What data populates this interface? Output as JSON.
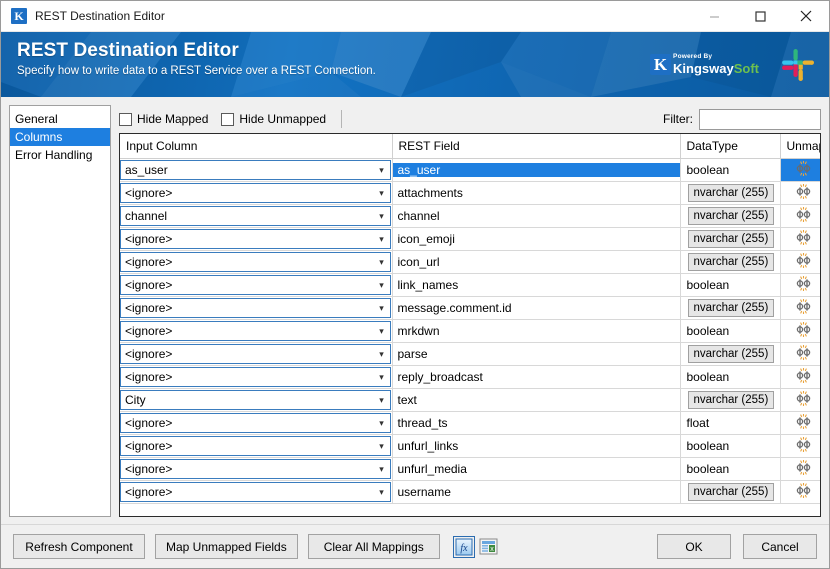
{
  "window": {
    "title": "REST Destination Editor",
    "app_icon": "kingswaysoft-k-icon",
    "minimize_label": "minimize-icon",
    "maximize_label": "maximize-icon",
    "close_label": "close-icon"
  },
  "banner": {
    "title": "REST Destination Editor",
    "subtitle": "Specify how to write data to a REST Service over a REST Connection.",
    "brand": {
      "k": "K",
      "powered_by": "Powered By",
      "name_part1": "Kingsway",
      "name_part2": "Soft"
    },
    "product_logo": "slack-logo"
  },
  "sidebar": {
    "items": [
      {
        "label": "General",
        "selected": false
      },
      {
        "label": "Columns",
        "selected": true
      },
      {
        "label": "Error Handling",
        "selected": false
      }
    ]
  },
  "toolbar": {
    "hide_mapped_label": "Hide Mapped",
    "hide_mapped_checked": false,
    "hide_unmapped_label": "Hide Unmapped",
    "hide_unmapped_checked": false,
    "filter_label": "Filter:",
    "filter_value": "",
    "filter_placeholder": ""
  },
  "grid": {
    "columns": [
      "Input Column",
      "REST Field",
      "DataType",
      "Unmap"
    ],
    "unmap_icon": "unmap-icon",
    "dropdown_icon": "chevron-down-icon",
    "rows": [
      {
        "input": "as_user",
        "rest": "as_user",
        "type": "boolean",
        "type_is_button": false,
        "selected": true
      },
      {
        "input": "<ignore>",
        "rest": "attachments",
        "type": "nvarchar (255)",
        "type_is_button": true,
        "selected": false
      },
      {
        "input": "channel",
        "rest": "channel",
        "type": "nvarchar (255)",
        "type_is_button": true,
        "selected": false
      },
      {
        "input": "<ignore>",
        "rest": "icon_emoji",
        "type": "nvarchar (255)",
        "type_is_button": true,
        "selected": false
      },
      {
        "input": "<ignore>",
        "rest": "icon_url",
        "type": "nvarchar (255)",
        "type_is_button": true,
        "selected": false
      },
      {
        "input": "<ignore>",
        "rest": "link_names",
        "type": "boolean",
        "type_is_button": false,
        "selected": false
      },
      {
        "input": "<ignore>",
        "rest": "message.comment.id",
        "type": "nvarchar (255)",
        "type_is_button": true,
        "selected": false
      },
      {
        "input": "<ignore>",
        "rest": "mrkdwn",
        "type": "boolean",
        "type_is_button": false,
        "selected": false
      },
      {
        "input": "<ignore>",
        "rest": "parse",
        "type": "nvarchar (255)",
        "type_is_button": true,
        "selected": false
      },
      {
        "input": "<ignore>",
        "rest": "reply_broadcast",
        "type": "boolean",
        "type_is_button": false,
        "selected": false
      },
      {
        "input": "City",
        "rest": "text",
        "type": "nvarchar (255)",
        "type_is_button": true,
        "selected": false
      },
      {
        "input": "<ignore>",
        "rest": "thread_ts",
        "type": "float",
        "type_is_button": false,
        "selected": false
      },
      {
        "input": "<ignore>",
        "rest": "unfurl_links",
        "type": "boolean",
        "type_is_button": false,
        "selected": false
      },
      {
        "input": "<ignore>",
        "rest": "unfurl_media",
        "type": "boolean",
        "type_is_button": false,
        "selected": false
      },
      {
        "input": "<ignore>",
        "rest": "username",
        "type": "nvarchar (255)",
        "type_is_button": true,
        "selected": false
      }
    ]
  },
  "footer": {
    "refresh_component": "Refresh Component",
    "map_unmapped_fields": "Map Unmapped Fields",
    "clear_all_mappings": "Clear All Mappings",
    "expression_icon": "fx-expression-icon",
    "export_icon": "export-spreadsheet-icon",
    "ok": "OK",
    "cancel": "Cancel"
  },
  "colors": {
    "accent": "#1e7fe0",
    "banner_blue": "#0f66b2",
    "brand_green": "#6ec04f"
  }
}
